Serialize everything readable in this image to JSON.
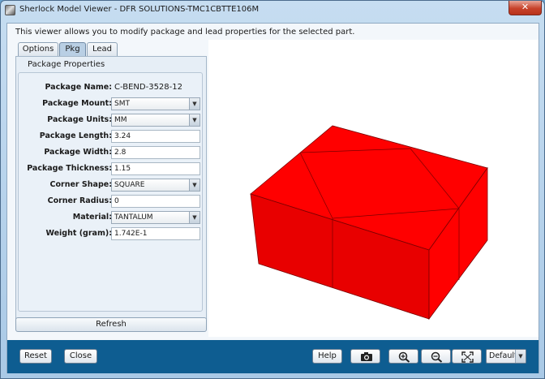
{
  "window": {
    "title": "Sherlock Model Viewer - DFR SOLUTIONS-TMC1CBTTE106M",
    "close_label": "✕"
  },
  "description": "This viewer allows you to modify package and lead properties for the selected part.",
  "tabs": [
    {
      "label": "Options",
      "active": false
    },
    {
      "label": "Pkg",
      "active": true
    },
    {
      "label": "Lead",
      "active": false
    }
  ],
  "panel": {
    "section_title": "Package Properties",
    "fields": [
      {
        "label": "Package Name:",
        "value": "C-BEND-3528-12",
        "kind": "text"
      },
      {
        "label": "Package Mount:",
        "value": "SMT",
        "kind": "combo"
      },
      {
        "label": "Package Units:",
        "value": "MM",
        "kind": "combo"
      },
      {
        "label": "Package Length:",
        "value": "3.24",
        "kind": "input"
      },
      {
        "label": "Package Width:",
        "value": "2.8",
        "kind": "input"
      },
      {
        "label": "Package Thickness:",
        "value": "1.15",
        "kind": "input"
      },
      {
        "label": "Corner Shape:",
        "value": "SQUARE",
        "kind": "combo"
      },
      {
        "label": "Corner Radius:",
        "value": "0",
        "kind": "input"
      },
      {
        "label": "Material:",
        "value": "TANTALUM",
        "kind": "combo"
      },
      {
        "label": "Weight (gram):",
        "value": "1.742E-1",
        "kind": "input"
      }
    ],
    "refresh_label": "Refresh"
  },
  "viewport": {
    "model_color": "#ff0000",
    "edge_color": "#6b0000"
  },
  "bottom": {
    "reset_label": "Reset",
    "close_label": "Close",
    "help_label": "Help",
    "view_select": "Default",
    "icons": [
      "camera-icon",
      "zoom-in-icon",
      "zoom-out-icon",
      "fit-view-icon"
    ]
  }
}
